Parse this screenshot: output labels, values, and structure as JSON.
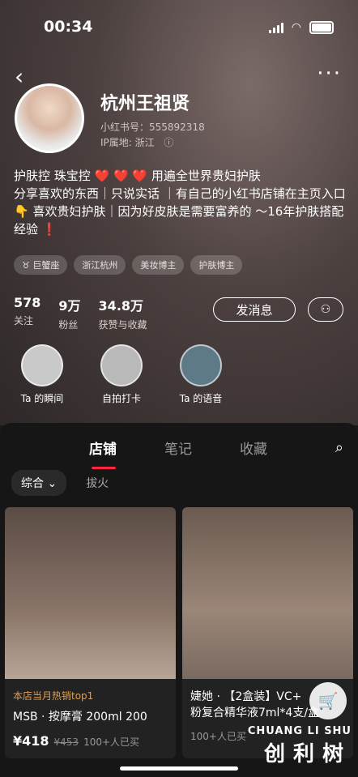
{
  "status": {
    "time": "00:34"
  },
  "profile": {
    "name": "杭州王祖贤",
    "id_label": "小红书号：555892318",
    "ip_label": "IP属地: 浙江",
    "bio_line1": "护肤控 珠宝控 ❤️ ❤️ ❤️ 用遍全世界贵妇护肤",
    "bio_line2": "分享喜欢的东西｜只说实话 ｜有自己的小红书店铺在主页入口",
    "bio_line3": "👇 喜欢贵妇护肤｜因为好皮肤是需要富养的 ～16年护肤搭配",
    "bio_line4": "经验 ❗",
    "tags": [
      "♉ 巨蟹座",
      "浙江杭州",
      "美妆博主",
      "护肤博主"
    ],
    "stats": [
      {
        "num": "578",
        "label": "关注"
      },
      {
        "num": "9万",
        "label": "粉丝"
      },
      {
        "num": "34.8万",
        "label": "获赞与收藏"
      }
    ],
    "message_button": "发消息",
    "highlights": [
      {
        "label": "Ta 的瞬间",
        "color": "#c9c9c9"
      },
      {
        "label": "自拍打卡",
        "color": "#b9b9b9"
      },
      {
        "label": "Ta 的语音",
        "color": "#5d7a86"
      }
    ]
  },
  "tabs": [
    "店铺",
    "笔记",
    "收藏"
  ],
  "filters": [
    "综合",
    "拔火"
  ],
  "products": [
    {
      "tagline": "本店当月热销top1",
      "title": "MSB · 按摩膏 200ml 200",
      "price": "¥418",
      "old_price": "¥453",
      "sold": "100+人已买",
      "img_color": "#6a5a50"
    },
    {
      "tagline": "",
      "title": "婕她 · 【2盒装】VC+",
      "title2": "粉复合精华液7ml*4支/盒",
      "price": "",
      "old_price": "",
      "sold": "100+人已买",
      "img_color": "#7b6a5f"
    }
  ],
  "watermark": {
    "en": "CHUANG LI SHU",
    "cn": "创利树"
  }
}
